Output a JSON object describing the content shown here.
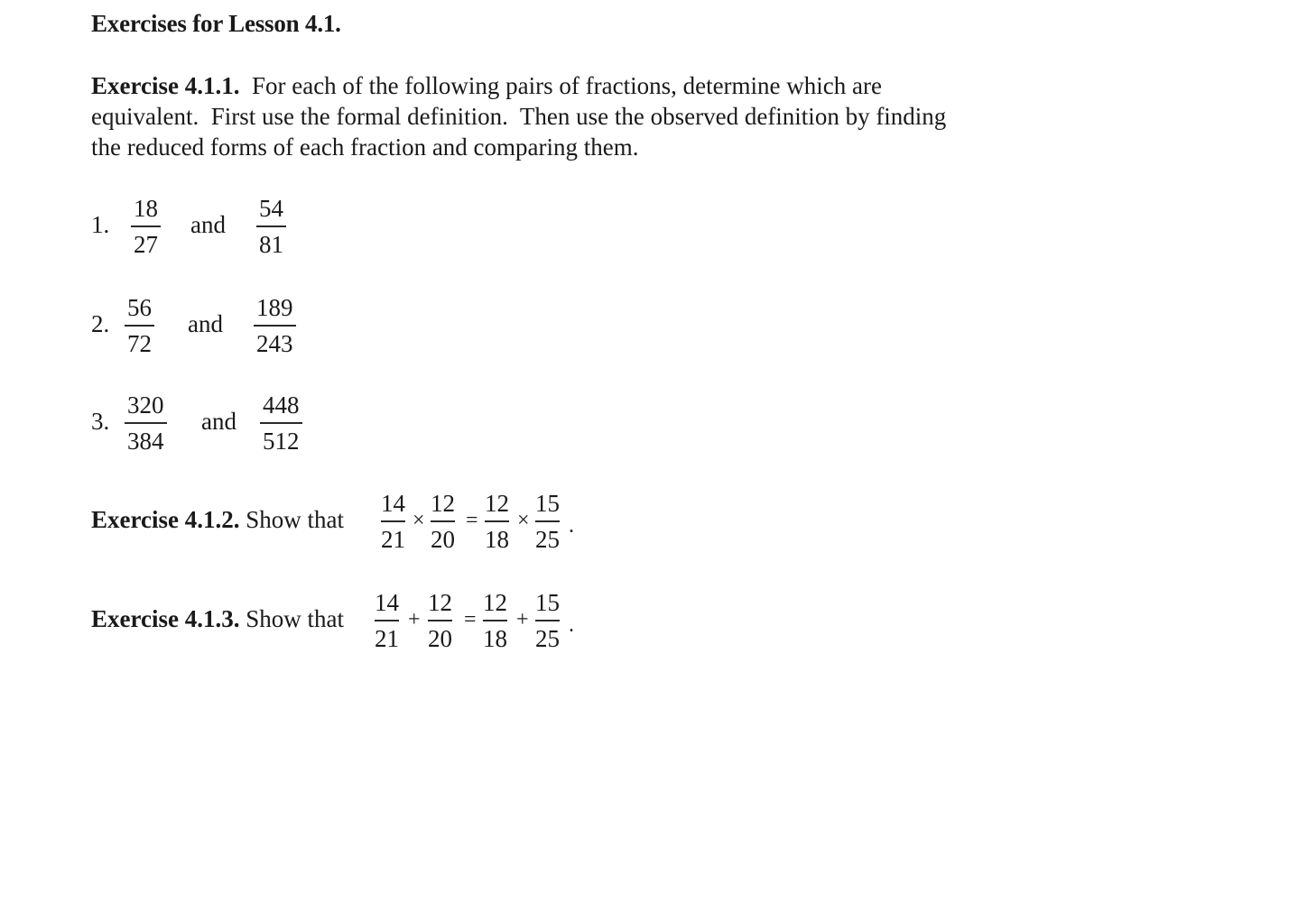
{
  "heading": "Exercises for Lesson 4.1.",
  "exercise_1": {
    "label": "Exercise 4.1.1.",
    "text_line1": "For each of the following pairs of fractions, determine which are",
    "text_line2": "equivalent.  First use the formal definition.  Then use the observed definition by finding",
    "text_line3": "the reduced forms of each fraction and comparing them.",
    "items": [
      {
        "number": "1.",
        "left": {
          "num": "18",
          "den": "27"
        },
        "connector": "and",
        "right": {
          "num": "54",
          "den": "81"
        }
      },
      {
        "number": "2.",
        "left": {
          "num": "56",
          "den": "72"
        },
        "connector": "and",
        "right": {
          "num": "189",
          "den": "243"
        }
      },
      {
        "number": "3.",
        "left": {
          "num": "320",
          "den": "384"
        },
        "connector": "and",
        "right": {
          "num": "448",
          "den": "512"
        }
      }
    ]
  },
  "exercise_2": {
    "label": "Exercise 4.1.2.",
    "text": "Show that",
    "fractions": [
      {
        "num": "14",
        "den": "21"
      },
      {
        "num": "12",
        "den": "20"
      },
      {
        "num": "12",
        "den": "18"
      },
      {
        "num": "15",
        "den": "25"
      }
    ],
    "op1": "×",
    "eq": "=",
    "op2": "×",
    "end": "."
  },
  "exercise_3": {
    "label": "Exercise 4.1.3.",
    "text": "Show that",
    "fractions": [
      {
        "num": "14",
        "den": "21"
      },
      {
        "num": "12",
        "den": "20"
      },
      {
        "num": "12",
        "den": "18"
      },
      {
        "num": "15",
        "den": "25"
      }
    ],
    "op1": "+",
    "eq": "=",
    "op2": "+",
    "end": "."
  }
}
